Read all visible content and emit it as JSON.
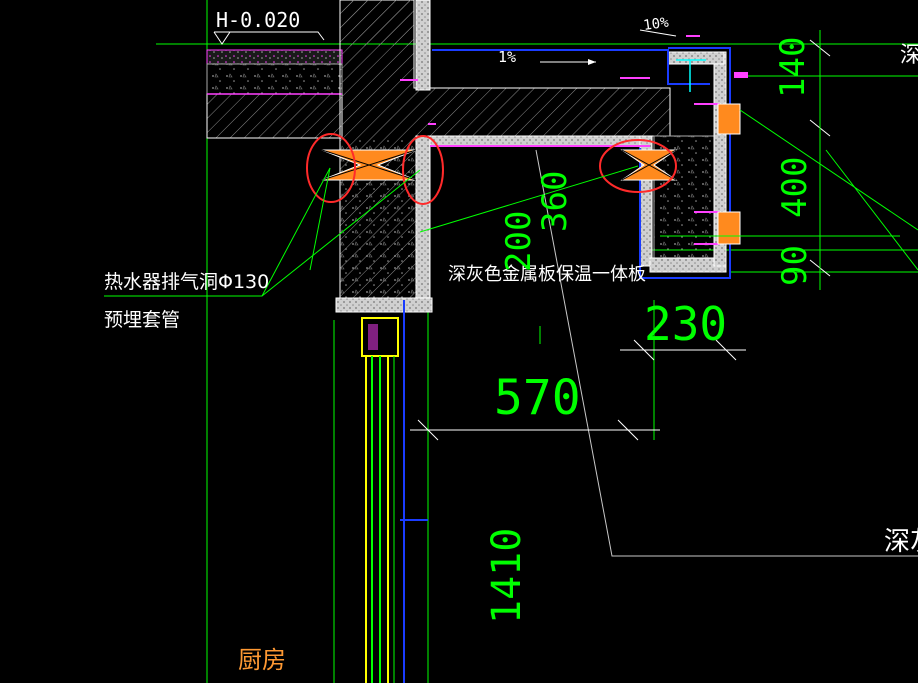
{
  "drawing": {
    "elevation_label": "H-0.020",
    "slope_small": "10%",
    "slope_main": "1%",
    "label_heater_vent": "热水器排气洞Φ130",
    "label_sleeve": "预埋套管",
    "label_metal_panel": "深灰色金属板保温一体板",
    "label_metal_panel_cut": "深灰",
    "label_right_top_cut": "深",
    "label_room": "厨房",
    "dim_140": "140",
    "dim_400": "400",
    "dim_90": "90",
    "dim_200": "200",
    "dim_360": "360",
    "dim_230": "230",
    "dim_570": "570",
    "dim_1410": "1410"
  },
  "colors": {
    "background": "#000000",
    "dimension": "#00ff00",
    "leader": "#c8c8c8",
    "highlight_circle": "#ff2a2a",
    "sleeve": "#ff8a1e",
    "insulation": "#1a3cff",
    "marker": "#ff40ff",
    "text_white": "#ffffff",
    "room_label": "#ff9933"
  }
}
